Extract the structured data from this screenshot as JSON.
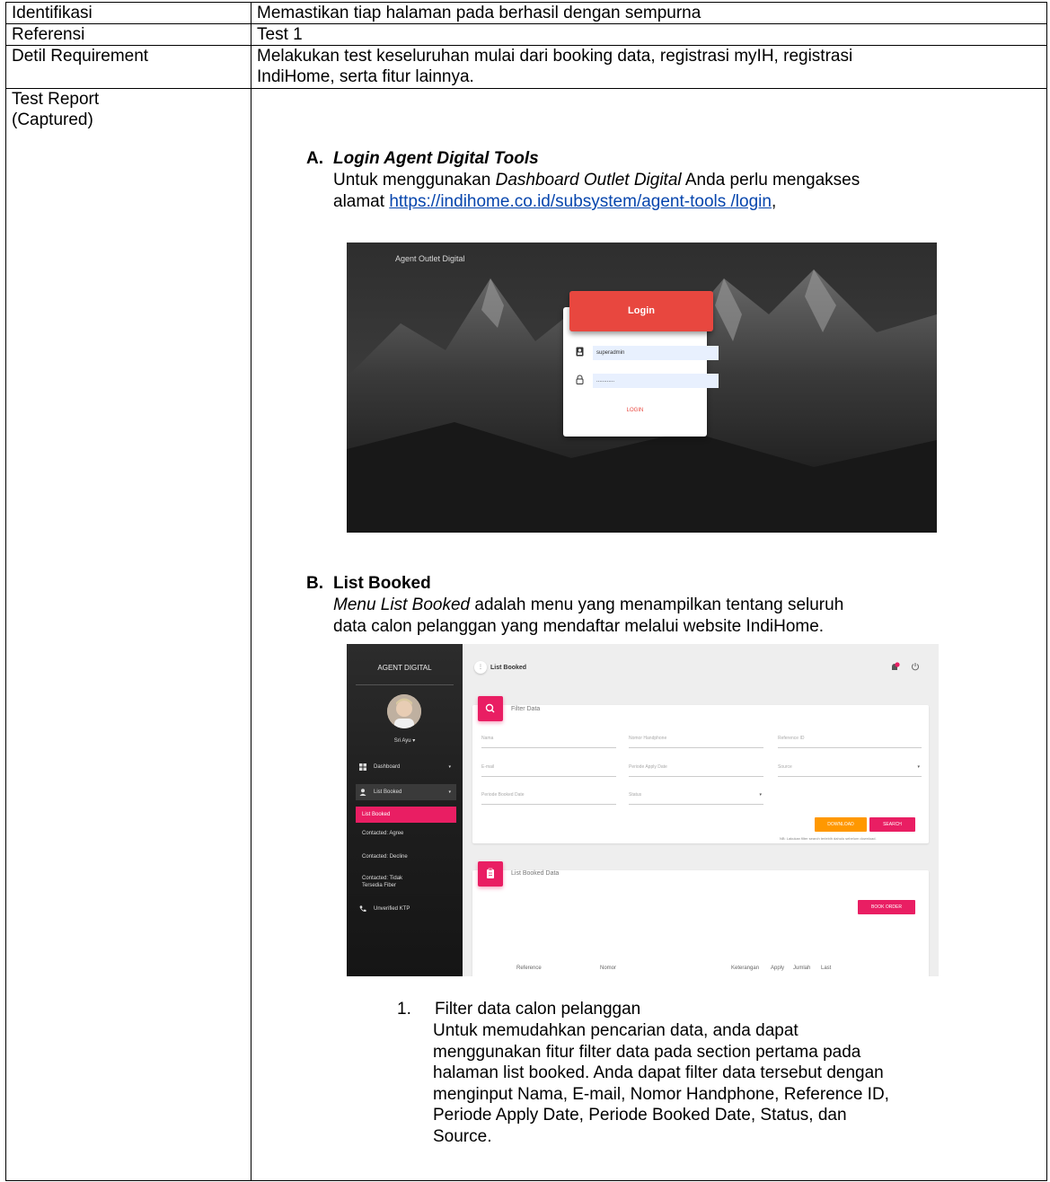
{
  "table": {
    "rows": [
      {
        "label": "Identifikasi",
        "value": "Memastikan tiap halaman pada berhasil dengan sempurna"
      },
      {
        "label": "Referensi",
        "value": "Test 1"
      },
      {
        "label": "Detil Requirement",
        "value_line1": "Melakukan test keseluruhan mulai dari booking data, registrasi myIH, registrasi",
        "value_line2": "IndiHome, serta fitur lainnya."
      }
    ],
    "report_label_line1": "Test Report",
    "report_label_line2": "(Captured)"
  },
  "section_a": {
    "number": "A.",
    "title": "Login Agent Digital Tools",
    "line1_prefix": "Untuk menggunakan ",
    "line1_italic": "Dashboard Outlet Digital",
    "line1_suffix": " Anda perlu mengakses",
    "line2_prefix": "alamat ",
    "link": "https://indihome.co.id/subsystem/agent-tools /login",
    "line2_suffix": ","
  },
  "login_screenshot": {
    "brand": "Agent Outlet Digital",
    "header": "Login",
    "username": "superadmin",
    "password": "............",
    "button": "LOGIN"
  },
  "section_b": {
    "number": "B.",
    "title": "List Booked",
    "line1_italic": "Menu List Booked",
    "line1_suffix": " adalah menu yang menampilkan tentang seluruh",
    "line2": "data calon pelanggan yang mendaftar melalui website IndiHome."
  },
  "list_screenshot": {
    "brand": "AGENT DIGITAL",
    "user": "Sri Ayu",
    "menu": {
      "dashboard": "Dashboard",
      "list_booked": "List Booked",
      "sub_active": "List Booked",
      "sub_agree": "Contacted: Agree",
      "sub_decline": "Contacted: Decline",
      "sub_tidak_1": "Contacted: Tidak",
      "sub_tidak_2": "Tersedia Fiber",
      "unverified": "Unverified KTP"
    },
    "page_title": "List Booked",
    "filter": {
      "title": "Filter Data",
      "nama": "Nama",
      "nomor": "Nomor Handphone",
      "reference": "Reference ID",
      "email": "E-mail",
      "periode_apply": "Periode Apply Date",
      "source": "Source",
      "periode_booked": "Periode Booked Date",
      "status": "Status",
      "download": "DOWNLOAD",
      "search": "SEARCH",
      "note": "NB: Lakukan filter search terlebih dahulu sebelum download."
    },
    "list_card": {
      "title": "List Booked Data",
      "book_order": "BOOK ORDER",
      "col_reference": "Reference",
      "col_nomor": "Nomor",
      "col_keterangan": "Keterangan",
      "col_apply": "Apply",
      "col_jumlah": "Jumlah",
      "col_last": "Last"
    },
    "colors": {
      "accent": "#e91e63",
      "download": "#ff9800",
      "login": "#e8473f"
    }
  },
  "list_item": {
    "number": "1.",
    "title": "Filter data calon pelanggan",
    "lines": [
      "Untuk memudahkan pencarian data, anda dapat",
      "menggunakan fitur filter data pada section pertama pada",
      "halaman list booked. Anda dapat filter data tersebut dengan",
      "menginput Nama, E-mail, Nomor Handphone, Reference ID,",
      "Periode Apply Date, Periode Booked Date, Status, dan",
      "Source."
    ]
  }
}
